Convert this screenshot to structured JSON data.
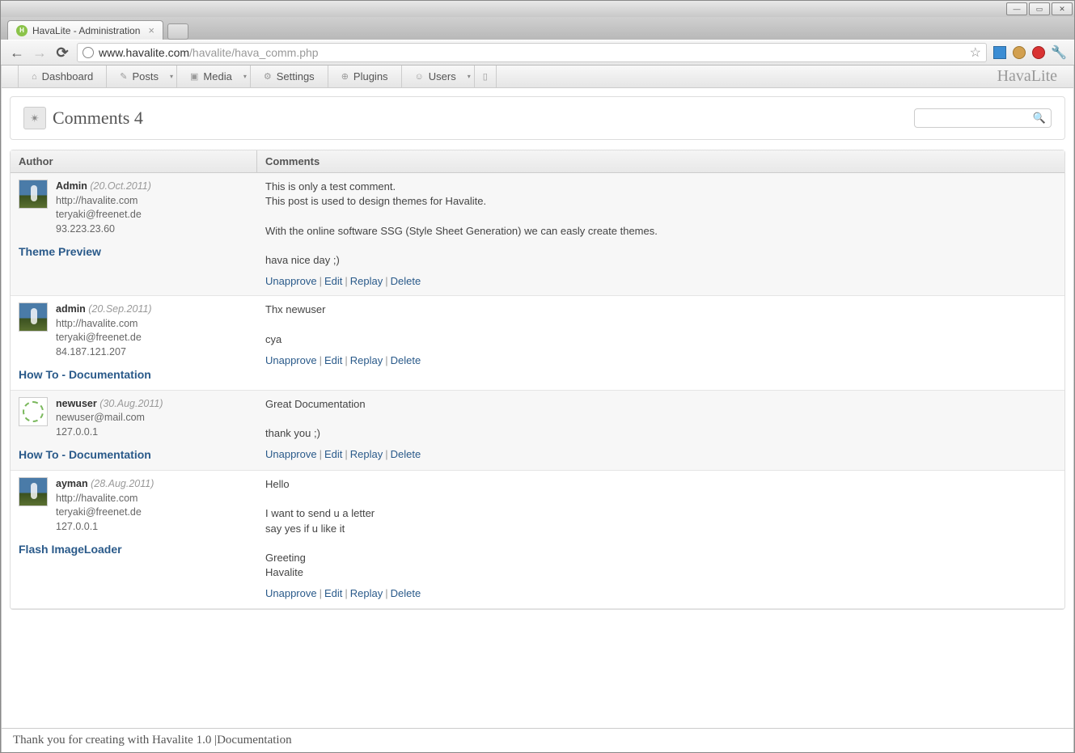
{
  "window": {
    "tab_title": "HavaLite - Administration",
    "url_host": "www.havalite.com",
    "url_path": "/havalite/hava_comm.php"
  },
  "nav": {
    "dashboard": "Dashboard",
    "posts": "Posts",
    "media": "Media",
    "settings": "Settings",
    "plugins": "Plugins",
    "users": "Users",
    "brand": "HavaLite"
  },
  "page": {
    "title": "Comments 4"
  },
  "table": {
    "header_author": "Author",
    "header_comments": "Comments"
  },
  "actions": {
    "unapprove": "Unapprove",
    "edit": "Edit",
    "replay": "Replay",
    "delete": "Delete"
  },
  "comments": [
    {
      "name": "Admin",
      "date": "(20.Oct.2011)",
      "url": "http://havalite.com",
      "email": "teryaki@freenet.de",
      "ip": "93.223.23.60",
      "post": "Theme Preview",
      "body": "This is only a test comment.\nThis post is used to design themes for Havalite.\n\nWith the online software SSG (Style Sheet Generation) we can easly create themes.\n\nhava nice day ;)",
      "avatar": "sky"
    },
    {
      "name": "admin",
      "date": "(20.Sep.2011)",
      "url": "http://havalite.com",
      "email": "teryaki@freenet.de",
      "ip": "84.187.121.207",
      "post": "How To - Documentation",
      "body": "Thx newuser\n\ncya",
      "avatar": "sky"
    },
    {
      "name": "newuser",
      "date": "(30.Aug.2011)",
      "url": "",
      "email": "newuser@mail.com",
      "ip": "127.0.0.1",
      "post": "How To - Documentation",
      "body": "Great Documentation\n\nthank you ;)",
      "avatar": "geo"
    },
    {
      "name": "ayman",
      "date": "(28.Aug.2011)",
      "url": "http://havalite.com",
      "email": "teryaki@freenet.de",
      "ip": "127.0.0.1",
      "post": "Flash ImageLoader",
      "body": "Hello\n\nI want to send u a letter\nsay yes if u like it\n\nGreeting\nHavalite",
      "avatar": "sky"
    }
  ],
  "footer": {
    "text_pre": "Thank you for creating with Havalite 1.0 | ",
    "doc_link": "Documentation"
  }
}
